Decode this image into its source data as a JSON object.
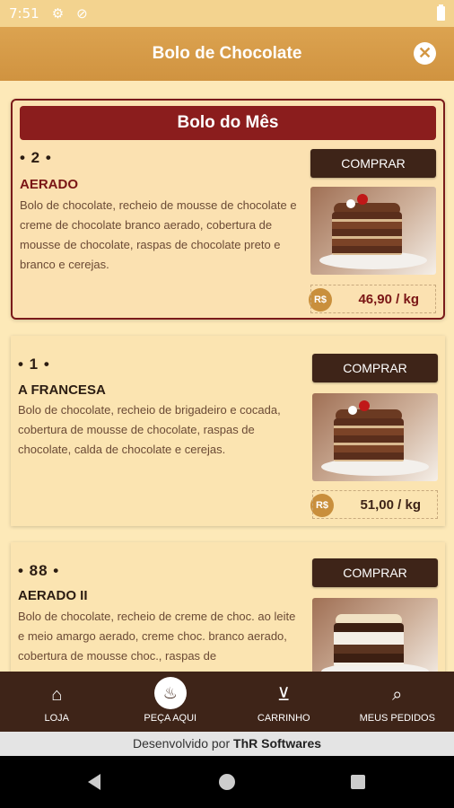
{
  "status_bar": {
    "time": "7:51"
  },
  "app_bar": {
    "title": "Bolo de Chocolate"
  },
  "featured": {
    "banner": "Bolo do Mês",
    "rank": "• 2 •",
    "name": "AERADO",
    "description": "Bolo de chocolate, recheio de mousse de chocolate e creme de chocolate branco aerado, cobertura de mousse de chocolate, raspas de chocolate preto e branco e cerejas.",
    "buy_label": "COMPRAR",
    "currency": "R$",
    "price": "46,90 / kg"
  },
  "products": [
    {
      "rank": "• 1 •",
      "name": "A FRANCESA",
      "description": "Bolo de chocolate, recheio de brigadeiro e cocada, cobertura de mousse de chocolate, raspas de chocolate, calda de chocolate e cerejas.",
      "buy_label": "COMPRAR",
      "currency": "R$",
      "price": "51,00 / kg"
    },
    {
      "rank": "• 88 •",
      "name": "AERADO II",
      "description": "Bolo de chocolate, recheio de creme de choc. ao leite e meio amargo aerado, creme choc. branco aerado, cobertura de mousse choc., raspas de",
      "buy_label": "COMPRAR"
    }
  ],
  "bottom_nav": [
    {
      "label": "LOJA",
      "icon": "home-icon"
    },
    {
      "label": "PEÇA AQUI",
      "icon": "cake-icon"
    },
    {
      "label": "CARRINHO",
      "icon": "basket-icon"
    },
    {
      "label": "MEUS PEDIDOS",
      "icon": "search-icon"
    }
  ],
  "footer": {
    "prefix": "Desenvolvido por",
    "company": "ThR Softwares"
  }
}
